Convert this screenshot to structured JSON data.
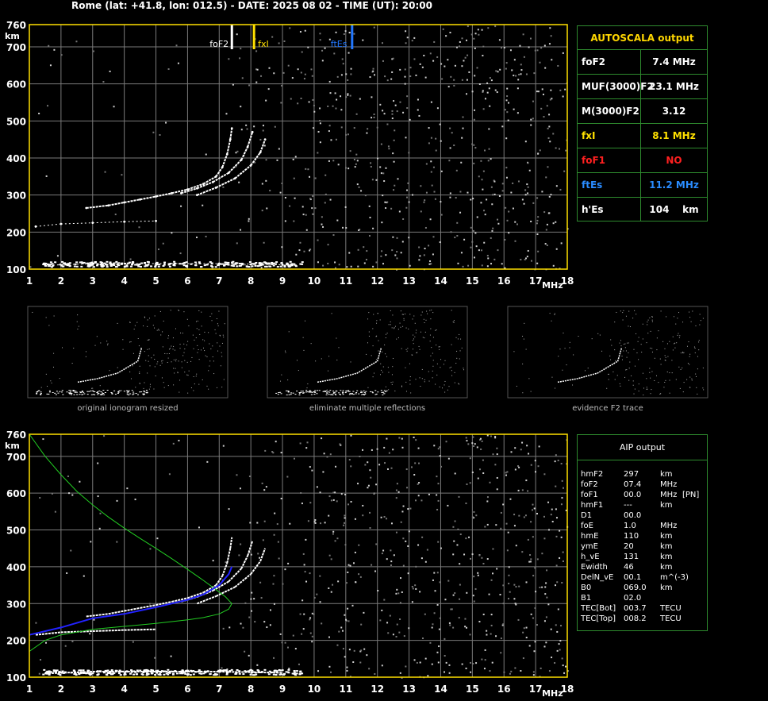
{
  "header": "Rome (lat: +41.8, lon: 012.5) - DATE: 2025 08 02 - TIME (UT): 20:00",
  "colors": {
    "grid": "#7a7a7a",
    "frame": "#ffe000",
    "panel_border": "#2e8b2e",
    "foF2": "#ffffff",
    "fxI": "#ffe000",
    "ftEs": "#2277ff",
    "foF1": "#ff2020",
    "profile": "#22cc22",
    "fit": "#2222ff"
  },
  "axes": {
    "x_ticks": [
      "1",
      "2",
      "3",
      "4",
      "5",
      "6",
      "7",
      "8",
      "9",
      "10",
      "11",
      "12",
      "13",
      "14",
      "15",
      "16",
      "17",
      "18"
    ],
    "x_unit": "MHz",
    "y_ticks": [
      "100",
      "200",
      "300",
      "400",
      "500",
      "600",
      "700",
      "760"
    ],
    "y_unit": "km"
  },
  "markers": [
    {
      "label": "foF2",
      "freq": 7.4,
      "color": "#ffffff"
    },
    {
      "label": "fxI",
      "freq": 8.1,
      "color": "#ffe000"
    },
    {
      "label": "ftEs",
      "freq": 11.2,
      "color": "#2277ff"
    }
  ],
  "thumbnails": [
    {
      "caption": "original ionogram resized"
    },
    {
      "caption": "eliminate multiple reflections"
    },
    {
      "caption": "evidence F2 trace"
    }
  ],
  "autoscala": {
    "title": "AUTOSCALA output",
    "rows": [
      {
        "label": "foF2",
        "value": "7.4 MHz",
        "color": "#ffffff"
      },
      {
        "label": "MUF(3000)F2",
        "value": "23.1 MHz",
        "color": "#ffffff"
      },
      {
        "label": "M(3000)F2",
        "value": "3.12",
        "color": "#ffffff"
      },
      {
        "label": "fxI",
        "value": "8.1 MHz",
        "color": "#ffe000"
      },
      {
        "label": "foF1",
        "value": "NO",
        "color": "#ff2020"
      },
      {
        "label": "ftEs",
        "value": "11.2 MHz",
        "color": "#2a8cff"
      },
      {
        "label": "h'Es",
        "value": "104    km",
        "color": "#ffffff"
      }
    ]
  },
  "aip": {
    "title": "AIP output",
    "rows": [
      {
        "name": "hmF2",
        "value": "297",
        "unit": "km",
        "extra": ""
      },
      {
        "name": "foF2",
        "value": "07.4",
        "unit": "MHz",
        "extra": ""
      },
      {
        "name": "foF1",
        "value": "00.0",
        "unit": "MHz",
        "extra": "[PN]"
      },
      {
        "name": "hmF1",
        "value": "---",
        "unit": "km",
        "extra": ""
      },
      {
        "name": "D1",
        "value": "00.0",
        "unit": "",
        "extra": ""
      },
      {
        "name": "foE",
        "value": "1.0",
        "unit": "MHz",
        "extra": ""
      },
      {
        "name": "hmE",
        "value": "110",
        "unit": "km",
        "extra": ""
      },
      {
        "name": "ymE",
        "value": "20",
        "unit": "km",
        "extra": ""
      },
      {
        "name": "h_vE",
        "value": "131",
        "unit": "km",
        "extra": ""
      },
      {
        "name": "Ewidth",
        "value": "46",
        "unit": "km",
        "extra": ""
      },
      {
        "name": "DelN_vE",
        "value": "00.1",
        "unit": "m^(-3)",
        "extra": ""
      },
      {
        "name": "B0",
        "value": "069.0",
        "unit": "km",
        "extra": ""
      },
      {
        "name": "B1",
        "value": "02.0",
        "unit": "",
        "extra": ""
      },
      {
        "name": "TEC[Bot]",
        "value": "003.7",
        "unit": "TECU",
        "extra": ""
      },
      {
        "name": "TEC[Top]",
        "value": "008.2",
        "unit": "TECU",
        "extra": ""
      }
    ]
  },
  "chart_data": [
    {
      "type": "scatter",
      "title": "",
      "xlabel": "MHz",
      "ylabel": "km",
      "xlim": [
        1,
        18
      ],
      "ylim": [
        100,
        760
      ],
      "grid": true,
      "series": [
        {
          "values": [
            [
              2.8,
              265
            ],
            [
              3.5,
              272
            ],
            [
              4.0,
              280
            ],
            [
              4.5,
              288
            ],
            [
              5.0,
              296
            ],
            [
              5.5,
              305
            ],
            [
              6.0,
              315
            ],
            [
              6.5,
              330
            ],
            [
              6.9,
              350
            ],
            [
              7.1,
              375
            ],
            [
              7.25,
              410
            ],
            [
              7.35,
              450
            ],
            [
              7.4,
              480
            ]
          ]
        },
        {
          "values": [
            [
              5.8,
              305
            ],
            [
              6.3,
              318
            ],
            [
              6.8,
              335
            ],
            [
              7.3,
              360
            ],
            [
              7.7,
              395
            ],
            [
              7.9,
              430
            ],
            [
              8.05,
              470
            ]
          ]
        },
        {
          "values": [
            [
              6.3,
              300
            ],
            [
              6.9,
              320
            ],
            [
              7.5,
              345
            ],
            [
              8.0,
              380
            ],
            [
              8.3,
              415
            ],
            [
              8.45,
              450
            ]
          ]
        },
        {
          "values": [
            [
              1.2,
              215
            ],
            [
              2.0,
              222
            ],
            [
              3.0,
              225
            ],
            [
              4.0,
              228
            ],
            [
              5.0,
              230
            ]
          ]
        },
        {
          "values": [
            [
              1.5,
              110
            ],
            [
              3.0,
              115
            ],
            [
              5.0,
              115
            ],
            [
              7.0,
              115
            ],
            [
              9.0,
              112
            ]
          ]
        }
      ]
    },
    {
      "type": "line",
      "title": "",
      "xlabel": "MHz",
      "ylabel": "km",
      "xlim": [
        1,
        18
      ],
      "ylim": [
        100,
        760
      ],
      "grid": true,
      "series": [
        {
          "values": [
            [
              1.0,
              760
            ],
            [
              1.5,
              700
            ],
            [
              2.0,
              650
            ],
            [
              2.5,
              605
            ],
            [
              3.0,
              568
            ],
            [
              3.5,
              535
            ],
            [
              4.0,
              505
            ],
            [
              4.5,
              477
            ],
            [
              5.0,
              450
            ],
            [
              5.5,
              422
            ],
            [
              6.0,
              393
            ],
            [
              6.5,
              363
            ],
            [
              6.9,
              338
            ],
            [
              7.2,
              318
            ],
            [
              7.4,
              300
            ],
            [
              7.3,
              285
            ],
            [
              7.0,
              272
            ],
            [
              6.5,
              262
            ],
            [
              6.0,
              256
            ],
            [
              5.0,
              246
            ],
            [
              4.0,
              238
            ],
            [
              3.0,
              230
            ],
            [
              2.0,
              215
            ],
            [
              1.5,
              200
            ],
            [
              1.0,
              170
            ]
          ]
        },
        {
          "values": [
            [
              1.0,
              215
            ],
            [
              2.0,
              235
            ],
            [
              3.0,
              260
            ],
            [
              4.0,
              272
            ],
            [
              5.0,
              290
            ],
            [
              6.0,
              310
            ],
            [
              6.5,
              325
            ],
            [
              7.0,
              350
            ],
            [
              7.3,
              380
            ],
            [
              7.4,
              400
            ]
          ]
        }
      ]
    }
  ]
}
